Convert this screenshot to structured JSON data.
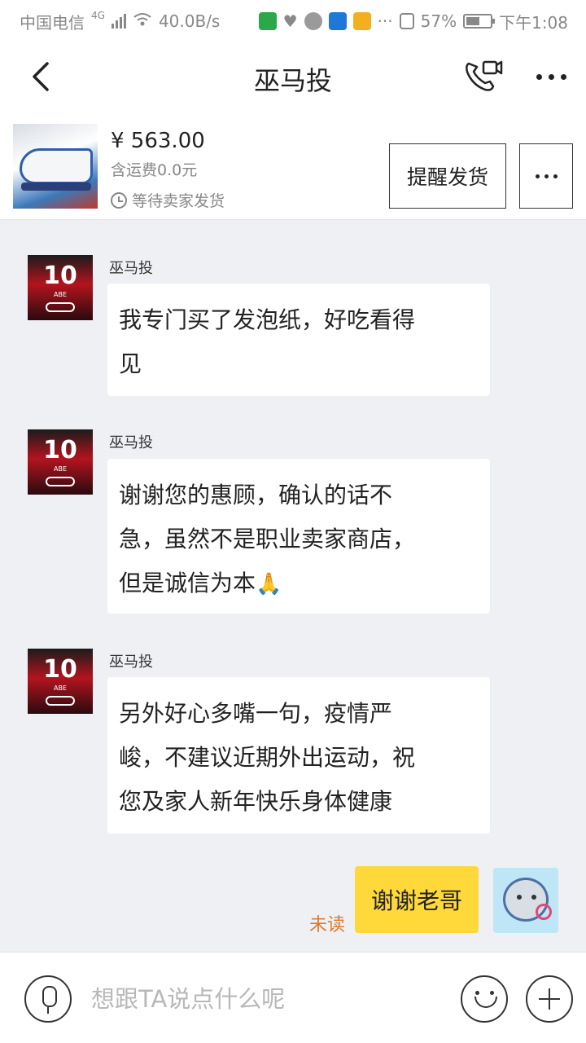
{
  "status_bar": {
    "carrier": "中国电信",
    "network": "4G",
    "speed": "40.0B/s",
    "battery": "57%",
    "battery_level": 0.57,
    "time": "下午1:08",
    "icons": [
      "signal-icon",
      "wifi-icon",
      "app-icon",
      "health-icon",
      "wechat-icon",
      "shield-icon",
      "app-icon",
      "more-dots-icon",
      "nfc-icon",
      "battery-icon"
    ]
  },
  "header": {
    "title": "巫马投",
    "back_icon": "back-arrow-icon",
    "call_icon": "phone-video-icon",
    "more_icon": "more-dots-icon"
  },
  "order": {
    "price": "¥ 563.00",
    "shipping": "含运费0.0元",
    "status": "等待卖家发货",
    "remind_button": "提醒发货",
    "more_button": "···"
  },
  "messages": [
    {
      "sender": "巫马投",
      "lines": [
        "我专门买了发泡纸，好吃看得",
        "见"
      ]
    },
    {
      "sender": "巫马投",
      "lines": [
        "谢谢您的惠顾，确认的话不",
        "急，虽然不是职业卖家商店，",
        "但是诚信为本"
      ],
      "emoji": "🙏"
    },
    {
      "sender": "巫马投",
      "lines": [
        "另外好心多嘴一句，疫情严",
        "峻，不建议近期外出运动，祝",
        "您及家人新年快乐身体健康"
      ]
    }
  ],
  "my_message": {
    "text": "谢谢老哥",
    "read_status": "未读"
  },
  "avatar_text": {
    "number": "10",
    "name": "ABE"
  },
  "input": {
    "placeholder": "想跟TA说点什么呢"
  },
  "colors": {
    "accent_yellow": "#ffd83a",
    "unread_orange": "#e07a2d",
    "chat_bg": "#eef0f4"
  }
}
